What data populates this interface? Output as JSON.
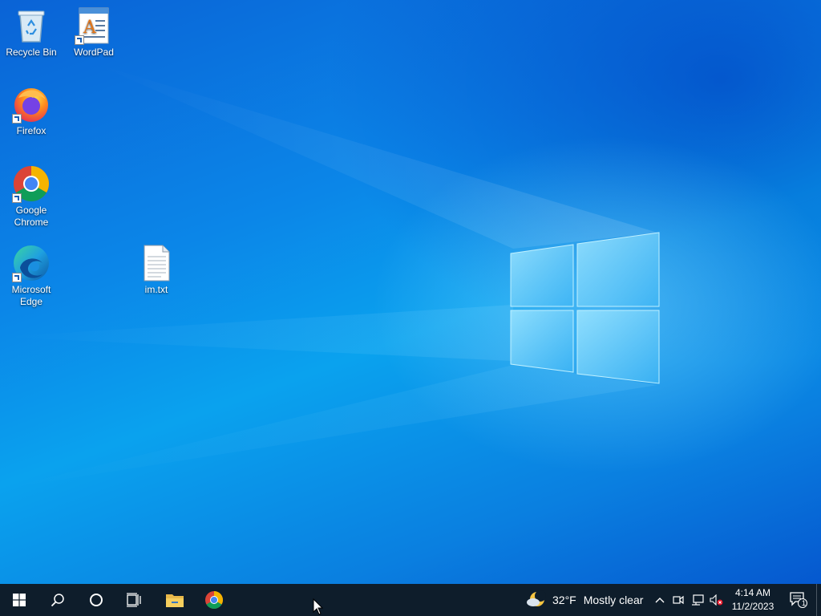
{
  "desktop": {
    "icons": [
      {
        "id": "recycle-bin",
        "label": "Recycle Bin"
      },
      {
        "id": "wordpad",
        "label": "WordPad"
      },
      {
        "id": "firefox",
        "label": "Firefox"
      },
      {
        "id": "chrome",
        "label_line1": "Google",
        "label_line2": "Chrome"
      },
      {
        "id": "edge",
        "label_line1": "Microsoft",
        "label_line2": "Edge"
      },
      {
        "id": "im-txt",
        "label": "im.txt"
      }
    ],
    "wallpaper_colors": {
      "primary": "#0a86e8",
      "dark": "#0558cf",
      "glow": "#78d2ff"
    }
  },
  "taskbar": {
    "background": "#0e1d2b",
    "buttons": [
      {
        "name": "start",
        "icon": "windows-logo-icon"
      },
      {
        "name": "search",
        "icon": "search-icon"
      },
      {
        "name": "cortana",
        "icon": "cortana-circle-icon"
      },
      {
        "name": "task-view",
        "icon": "task-view-icon"
      },
      {
        "name": "file-explorer",
        "icon": "folder-icon"
      },
      {
        "name": "chrome",
        "icon": "chrome-icon"
      }
    ],
    "weather": {
      "temperature": "32°F",
      "condition": "Mostly clear",
      "icon": "moon-cloud-icon"
    },
    "tray_icons": [
      "chevron-up-icon",
      "meet-now-icon",
      "network-icon",
      "volume-muted-icon"
    ],
    "clock": {
      "time": "4:14 AM",
      "date": "11/2/2023"
    },
    "notifications": {
      "count": "1",
      "icon": "action-center-icon"
    }
  }
}
